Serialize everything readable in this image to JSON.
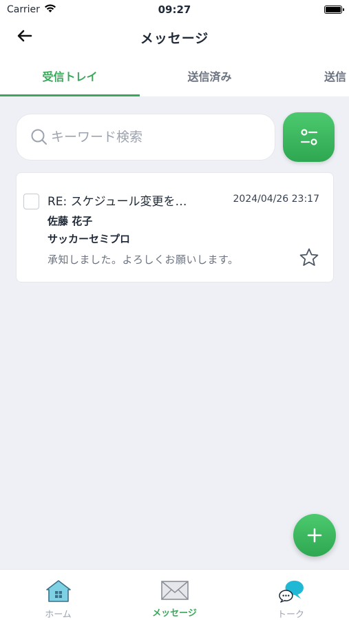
{
  "status_bar": {
    "carrier": "Carrier",
    "time": "09:27"
  },
  "nav": {
    "title": "メッセージ"
  },
  "tabs": [
    {
      "label": "受信トレイ",
      "active": true
    },
    {
      "label": "送信済み",
      "active": false
    },
    {
      "label": "送信",
      "active": false
    }
  ],
  "search": {
    "placeholder": "キーワード検索",
    "value": ""
  },
  "messages": [
    {
      "subject": "RE: スケジュール変更を…",
      "date": "2024/04/26 23:17",
      "sender": "佐藤 花子",
      "organization": "サッカーセミプロ",
      "preview": "承知しました。よろしくお願いします。",
      "starred": false,
      "checked": false
    }
  ],
  "bottom_nav": [
    {
      "label": "ホーム",
      "icon": "home-icon",
      "active": false
    },
    {
      "label": "メッセージ",
      "icon": "envelope-icon",
      "active": true
    },
    {
      "label": "トーク",
      "icon": "chat-bubbles-icon",
      "active": false
    }
  ],
  "colors": {
    "accent": "#3aa85a",
    "background": "#eef0f5"
  }
}
